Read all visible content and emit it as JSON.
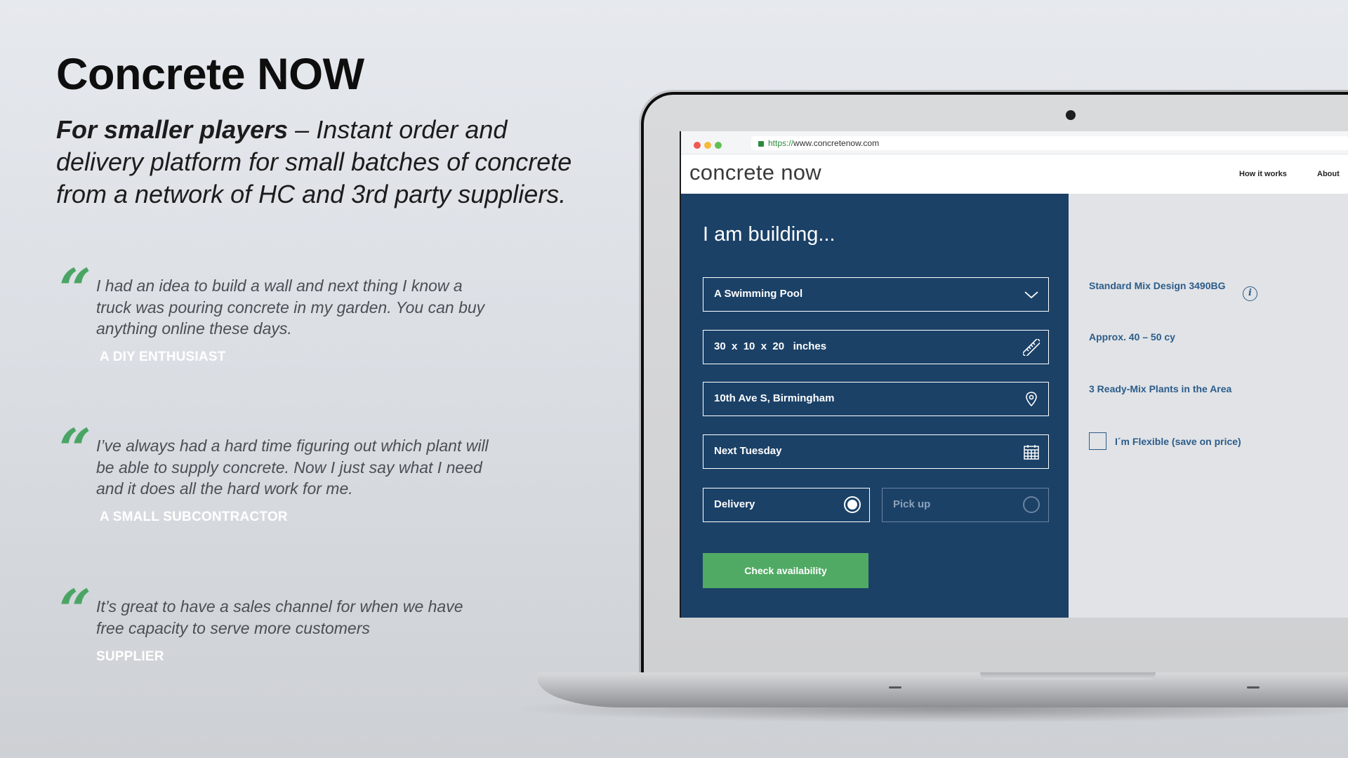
{
  "headline": "Concrete NOW",
  "tagline": {
    "bold": "For smaller players",
    "rest": " – Instant order and delivery platform for small batches of concrete from a network of HC and 3rd party suppliers."
  },
  "testimonials": [
    {
      "quote": "I had an idea to build a wall and next thing I know a truck was pouring concrete in my garden. You can buy anything online these days.",
      "author": "A DIY ENTHUSIAST"
    },
    {
      "quote": "I’ve always had a hard time figuring out which plant will be able to supply concrete. Now I just say what I need and it does all the hard work for me.",
      "author": "A SMALL SUBCONTRACTOR"
    },
    {
      "quote": "It’s great to have a sales channel for when we have free capacity to serve more customers",
      "author": "SUPPLIER"
    }
  ],
  "browser": {
    "url_proto": "https://",
    "url_rest": "www.concretenow.com"
  },
  "site": {
    "logo": "concrete now",
    "nav": [
      "How it works",
      "About"
    ]
  },
  "form": {
    "title": "I am building...",
    "project_type": "A Swimming Pool",
    "dimensions": "30  x  10  x  20   inches",
    "location": "10th Ave S, Birmingham",
    "date": "Next Tuesday",
    "options": [
      "Delivery",
      "Pick up"
    ],
    "selected_option": "Delivery",
    "cta": "Check availability"
  },
  "summary": {
    "mix_design": "Standard Mix Design 3490BG",
    "volume": "Approx. 40 – 50 cy",
    "plants": "3 Ready-Mix Plants in the Area",
    "flexible_label": "I´m Flexible (save on price)",
    "flexible_checked": false,
    "info_glyph": "i"
  },
  "colors": {
    "accent_green": "#50aa64",
    "panel_blue": "#1b4167",
    "link_blue": "#2c5c89"
  }
}
